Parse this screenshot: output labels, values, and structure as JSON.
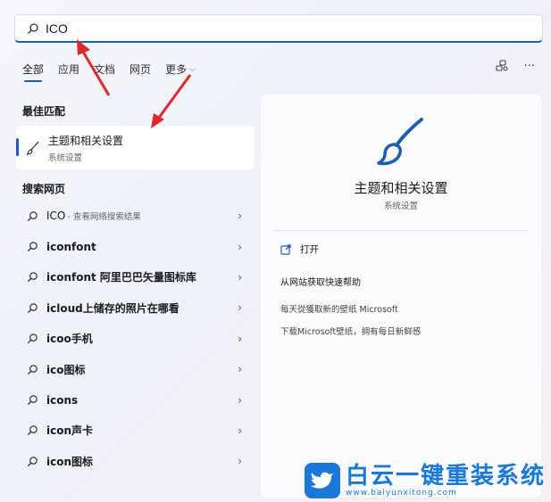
{
  "search": {
    "value": "ICO"
  },
  "tabs": [
    {
      "label": "全部"
    },
    {
      "label": "应用"
    },
    {
      "label": "文档"
    },
    {
      "label": "网页"
    },
    {
      "label": "更多"
    }
  ],
  "toolbar": {
    "more_label": "···"
  },
  "best_match": {
    "section_title": "最佳匹配",
    "title": "主题和相关设置",
    "subtitle": "系统设置"
  },
  "web": {
    "section_title": "搜索网页",
    "items": [
      {
        "text": "ICO",
        "sub": " - 查看网络搜索结果"
      },
      {
        "text": "iconfont"
      },
      {
        "text": "iconfont 阿里巴巴矢量图标库"
      },
      {
        "text": "icloud上储存的照片在哪看"
      },
      {
        "text": "icoo手机"
      },
      {
        "text": "ico图标"
      },
      {
        "text": "icons"
      },
      {
        "text": "icon声卡"
      },
      {
        "text": "icon图标"
      }
    ]
  },
  "detail": {
    "title": "主题和相关设置",
    "subtitle": "系统设置",
    "open_label": "打开",
    "help_title": "从网站获取快速帮助",
    "link1": "每天從獲取新的壁纸 Microsoft",
    "link2": "下载Microsoft壁纸，拥有每日新鲜感"
  },
  "watermark": {
    "main": "白云一键重装系统",
    "url": "www.baiyunxitong.com"
  },
  "colors": {
    "accent": "#1a5fb4",
    "annotation": "#e0282c",
    "watermark": "#1a79d8"
  }
}
